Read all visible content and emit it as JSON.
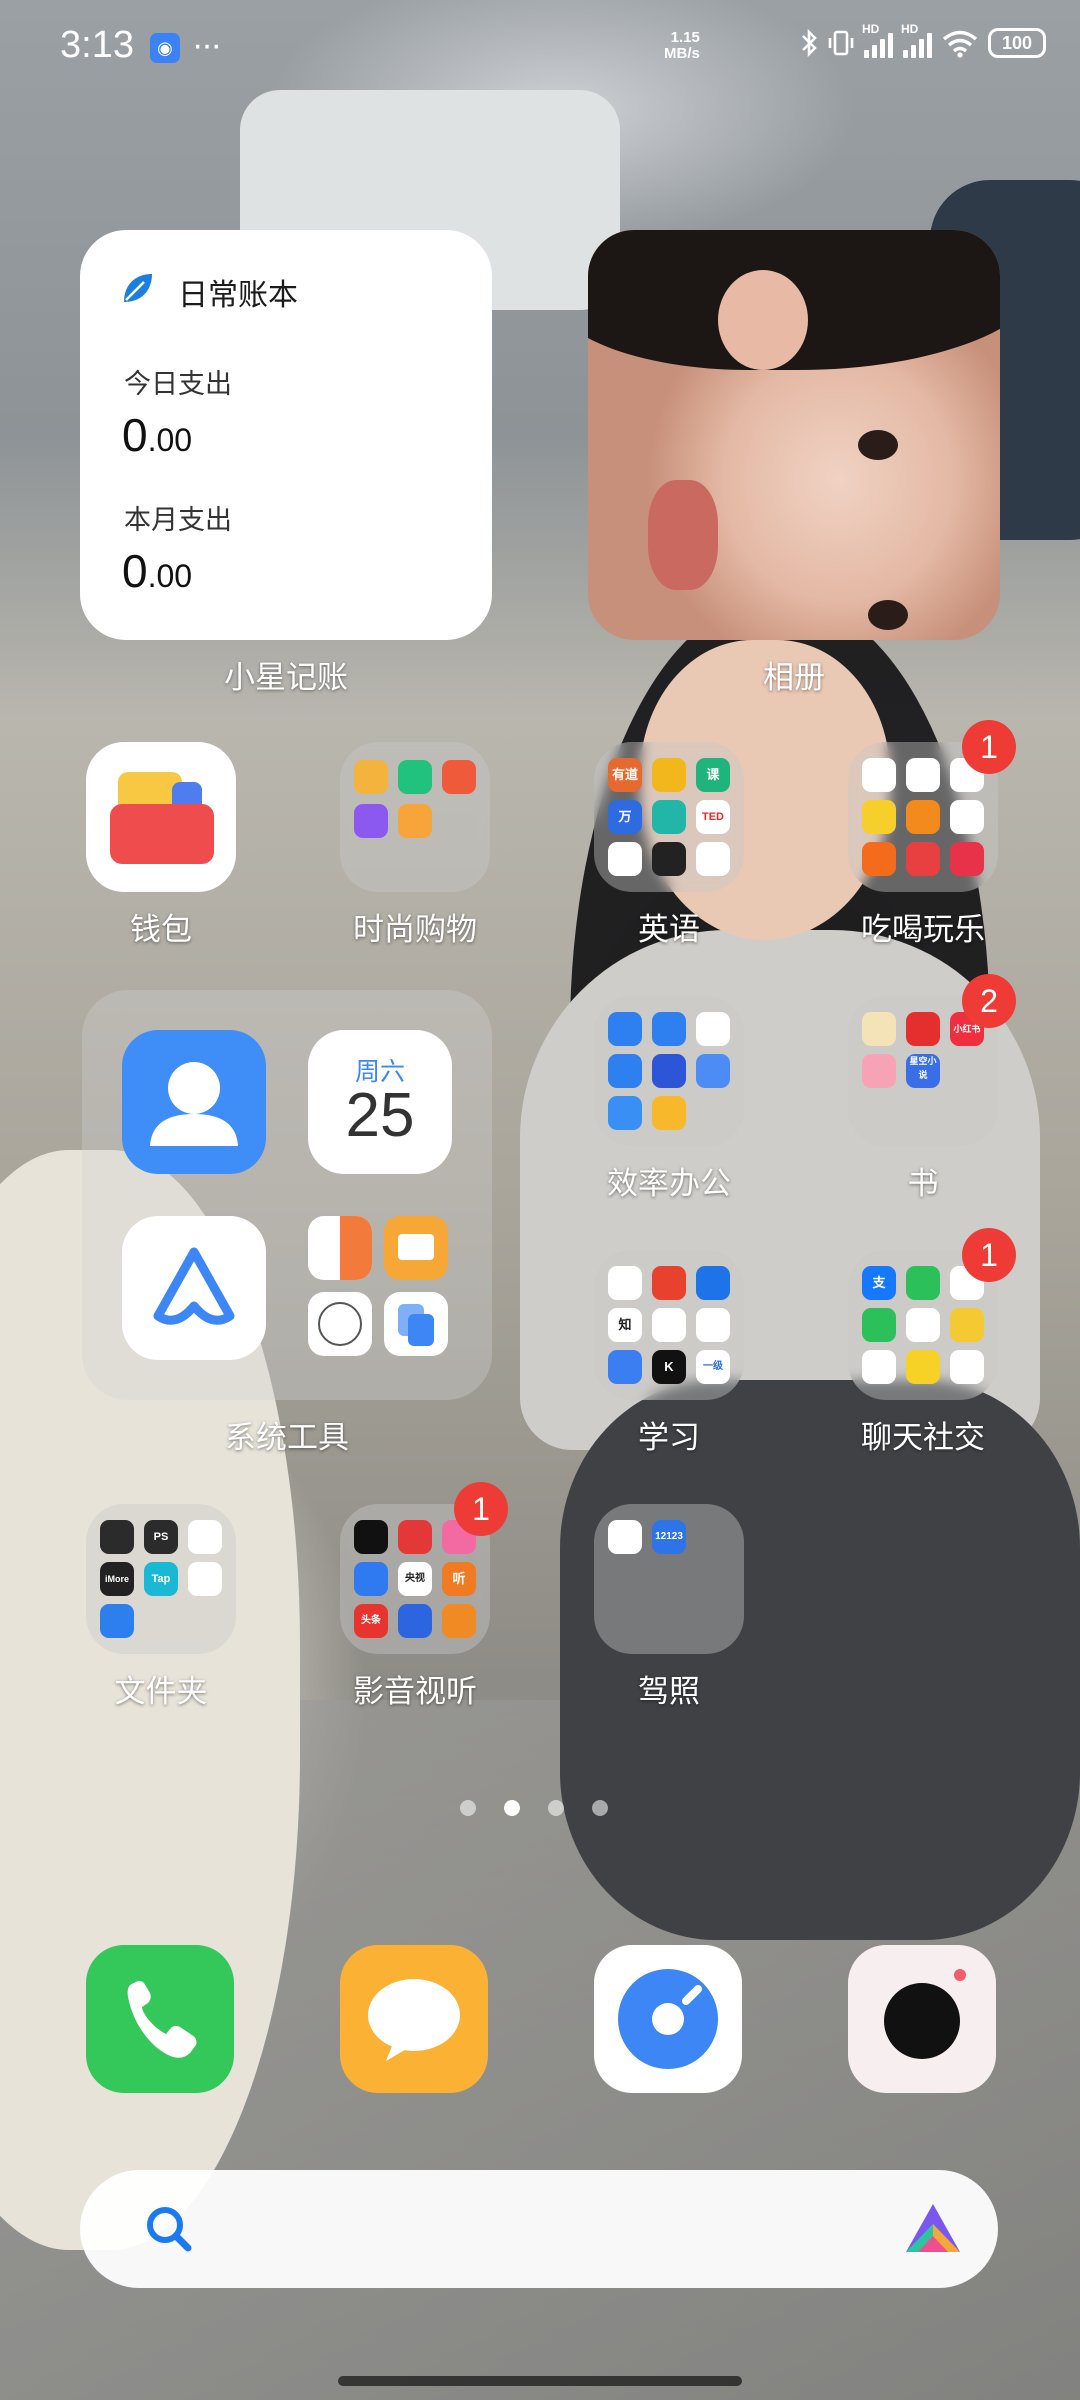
{
  "status_bar": {
    "time": "3:13",
    "net_speed_value": "1.15",
    "net_speed_unit": "MB/s",
    "hd1": "HD",
    "hd2": "HD",
    "battery": "100"
  },
  "ledger_widget": {
    "title": "日常账本",
    "today_label": "今日支出",
    "today_int": "0",
    "today_dec": ".00",
    "month_label": "本月支出",
    "month_int": "0",
    "month_dec": ".00",
    "caption": "小星记账"
  },
  "photo_widget": {
    "caption": "相册"
  },
  "apps": {
    "wallet": "钱包",
    "fashion": "时尚购物",
    "english": "英语",
    "food": "吃喝玩乐",
    "office": "效率办公",
    "books": "书",
    "system_tools": "系统工具",
    "study": "学习",
    "social": "聊天社交",
    "folder": "文件夹",
    "media": "影音视听",
    "license": "驾照"
  },
  "badges": {
    "food": "1",
    "books": "2",
    "social": "1",
    "media": "1"
  },
  "calendar": {
    "weekday": "周六",
    "day": "25"
  },
  "mini_labels": {
    "english": [
      "有道",
      "",
      "课",
      "万",
      "",
      "TED",
      "",
      "",
      ""
    ],
    "study": [
      "",
      "",
      "",
      "知",
      "",
      "",
      "",
      "K",
      "一级"
    ],
    "social": [
      "支",
      "",
      "",
      "",
      "",
      "",
      "",
      "",
      ""
    ],
    "folder": [
      "",
      "PS",
      "",
      "iMore",
      "Tap",
      "",
      "",
      "",
      ""
    ],
    "media": [
      "",
      "",
      "",
      "",
      "央视",
      "听",
      "头条",
      "",
      ""
    ],
    "books": [
      "",
      "",
      "小红书",
      "",
      "星空小说",
      "",
      "",
      "",
      ""
    ],
    "license": [
      "",
      "12123"
    ]
  },
  "icons": {
    "leaf": "leaf-icon",
    "phone": "phone-icon",
    "messages": "message-icon",
    "browser": "compass-icon",
    "camera": "camera-icon",
    "search": "search-icon",
    "assistant": "assistant-icon"
  },
  "colors": {
    "badge": "#ef3b36",
    "accent_blue": "#3d86f5"
  },
  "pager": {
    "count": 4,
    "active_index": 1
  }
}
